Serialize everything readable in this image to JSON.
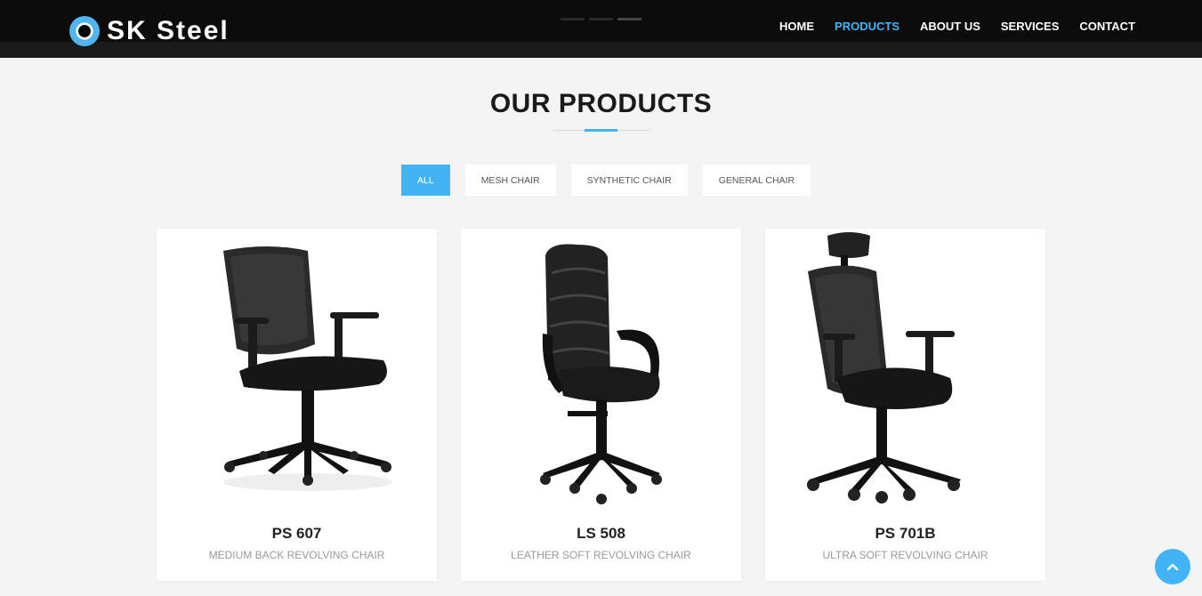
{
  "header": {
    "logo_text": "SK Steel",
    "nav": [
      {
        "label": "HOME",
        "active": false
      },
      {
        "label": "PRODUCTS",
        "active": true
      },
      {
        "label": "ABOUT US",
        "active": false
      },
      {
        "label": "SERVICES",
        "active": false
      },
      {
        "label": "CONTACT",
        "active": false
      }
    ]
  },
  "section": {
    "title": "OUR PRODUCTS"
  },
  "filters": [
    {
      "label": "ALL",
      "active": true
    },
    {
      "label": "MESH CHAIR",
      "active": false
    },
    {
      "label": "SYNTHETIC CHAIR",
      "active": false
    },
    {
      "label": "GENERAL CHAIR",
      "active": false
    }
  ],
  "products": [
    {
      "name": "PS 607",
      "description": "MEDIUM BACK REVOLVING CHAIR",
      "image": "mesh-mid-back-chair"
    },
    {
      "name": "LS 508",
      "description": "LEATHER SOFT REVOLVING CHAIR",
      "image": "leather-high-back-chair"
    },
    {
      "name": "PS 701B",
      "description": "ULTRA SOFT REVOLVING CHAIR",
      "image": "mesh-headrest-chair"
    }
  ],
  "icons": {
    "logo": "logo-eye-icon",
    "back_to_top": "chevron-up-icon"
  },
  "colors": {
    "accent": "#42b3f4",
    "header_bg": "#0c0c0c",
    "page_bg": "#f4f4f4"
  }
}
